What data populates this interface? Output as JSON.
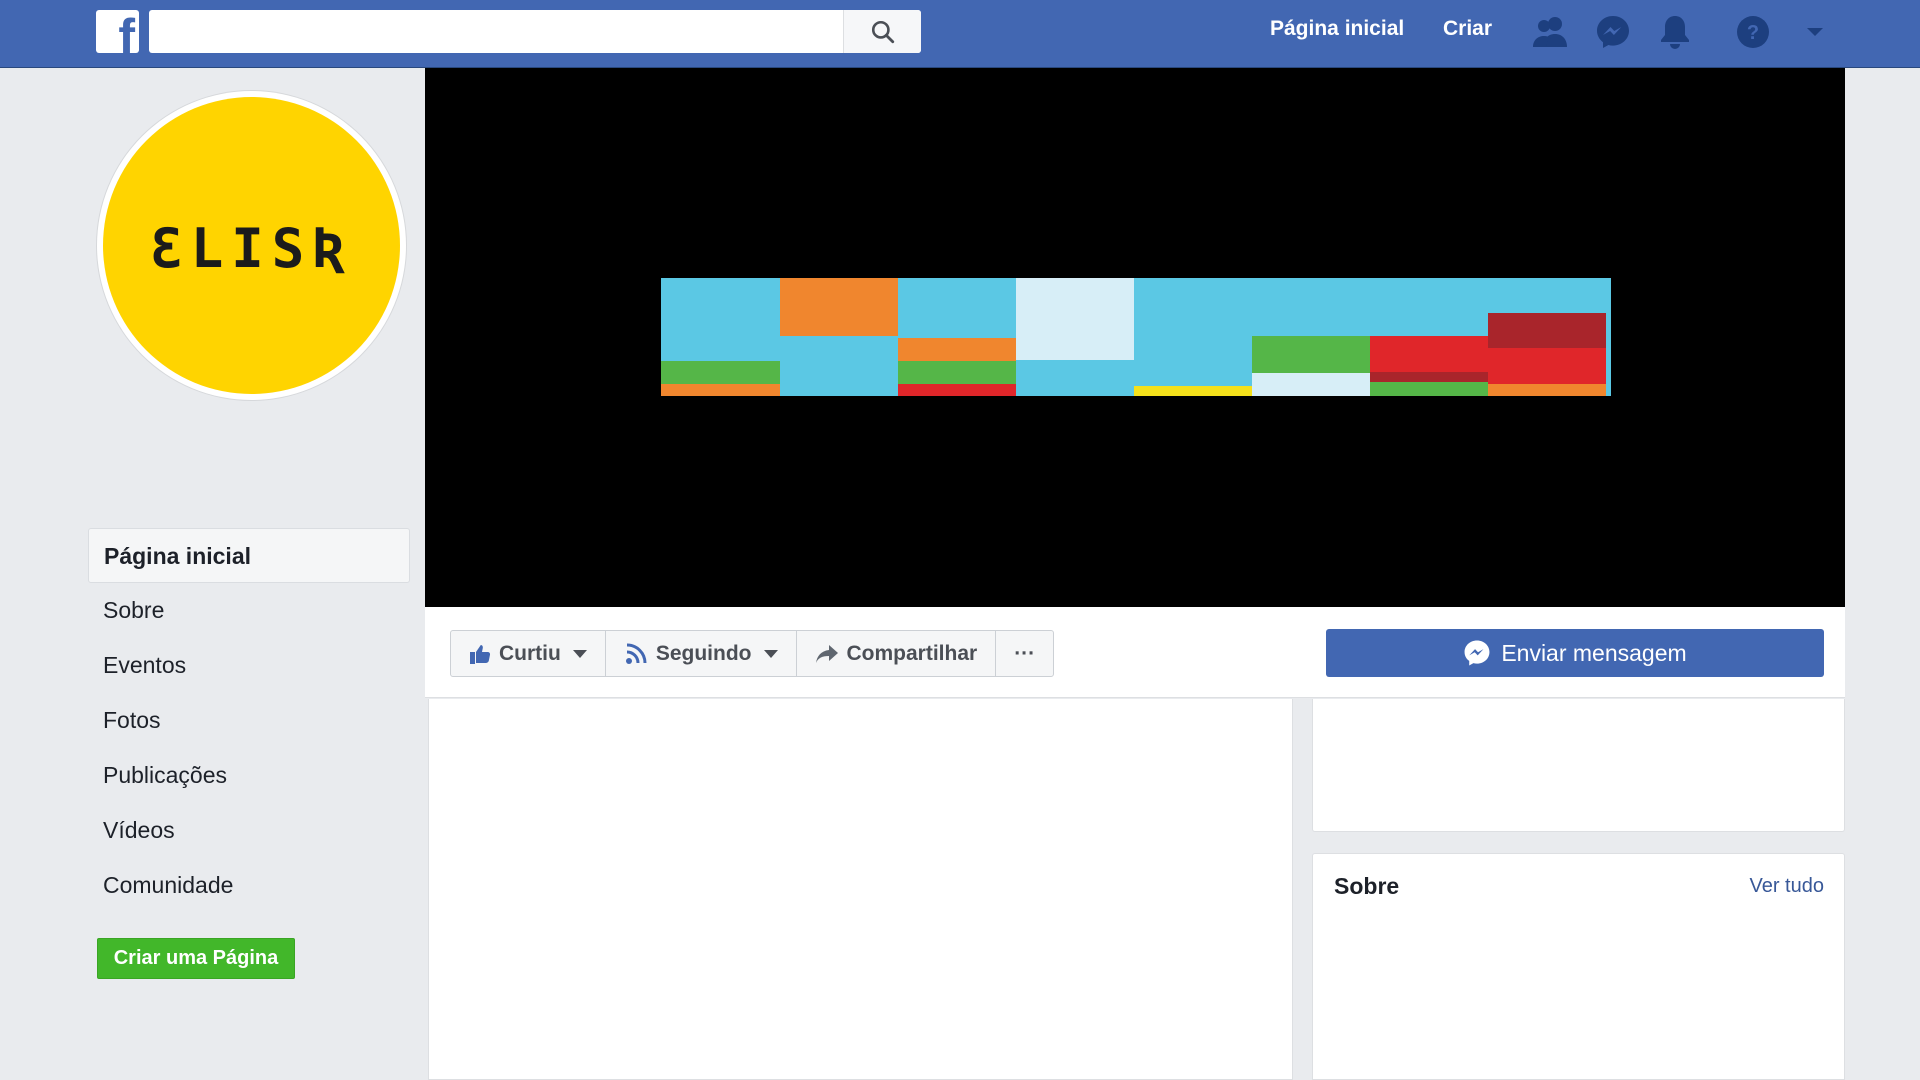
{
  "topbar": {
    "logo_letter": "f",
    "search_placeholder": "",
    "nav_home": "Página inicial",
    "nav_create": "Criar",
    "icons": [
      "search-icon",
      "friends-icon",
      "messenger-icon",
      "notifications-icon",
      "help-icon",
      "dropdown-icon"
    ],
    "bar_color": "#4267b2"
  },
  "profile": {
    "logo_text": "ƐLISƦ",
    "logo_bg_color": "#ffd400"
  },
  "leftnav": {
    "items": [
      {
        "label": "Página inicial",
        "active": true
      },
      {
        "label": "Sobre"
      },
      {
        "label": "Eventos"
      },
      {
        "label": "Fotos"
      },
      {
        "label": "Publicações"
      },
      {
        "label": "Vídeos"
      },
      {
        "label": "Comunidade"
      }
    ],
    "create_page_label": "Criar uma Página"
  },
  "actions": {
    "like_label": "Curtiu",
    "follow_label": "Seguindo",
    "share_label": "Compartilhar",
    "more_label": "···",
    "message_label": "Enviar mensagem"
  },
  "about": {
    "title": "Sobre",
    "see_all": "Ver tudo"
  },
  "colors": {
    "accent": "#4267b2",
    "green_button": "#42b72a",
    "link": "#385898"
  }
}
